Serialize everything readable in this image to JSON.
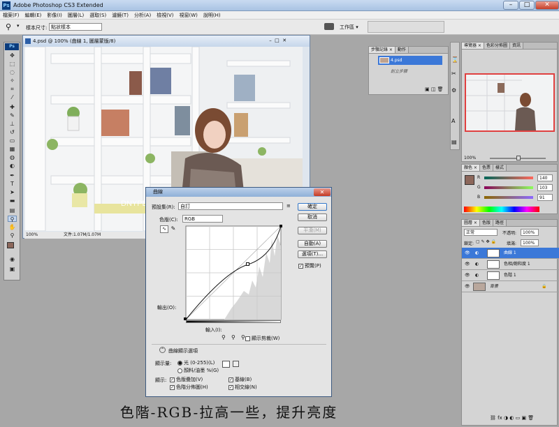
{
  "app": {
    "title": "Adobe Photoshop CS3 Extended",
    "logo": "Ps",
    "window_buttons": [
      "–",
      "□",
      "✕"
    ]
  },
  "menu": [
    "檔案(F)",
    "編輯(E)",
    "影像(I)",
    "圖層(L)",
    "選取(S)",
    "濾鏡(T)",
    "分析(A)",
    "檢視(V)",
    "視窗(W)",
    "說明(H)"
  ],
  "options": {
    "sample_label": "樣本尺寸:",
    "sample_value": "點狀樣本",
    "workspace": "工作區 ▾"
  },
  "document": {
    "title": "4.psd @ 100% (曲線 1, 圖層蒙版/8)",
    "zoom": "100%",
    "file_info": "文件:1.07M/1.07M",
    "watermark": "DNYPER"
  },
  "history": {
    "tabs": [
      "步驟記錄 ×",
      "動作"
    ],
    "items": [
      "4.psd",
      "創立步驟"
    ]
  },
  "navigator": {
    "tabs": [
      "導覽器 ×",
      "色彩分佈圖",
      "資訊"
    ],
    "zoom": "100%"
  },
  "color_panel": {
    "tabs": [
      "顏色 ×",
      "色票",
      "樣式"
    ],
    "channels": [
      {
        "name": "R",
        "value": "140"
      },
      {
        "name": "G",
        "value": "103"
      },
      {
        "name": "B",
        "value": "91"
      }
    ],
    "foreground": "#8c675b"
  },
  "layers": {
    "tabs": [
      "圖層 ×",
      "色版",
      "路徑"
    ],
    "blend_mode": "正常",
    "opacity_label": "不透明:",
    "opacity": "100%",
    "lock_label": "鎖定:",
    "fill_label": "填滿:",
    "fill": "100%",
    "items": [
      {
        "name": "曲線 1",
        "selected": true
      },
      {
        "name": "色相/飽和度 1",
        "selected": false
      },
      {
        "name": "色階 1",
        "selected": false
      },
      {
        "name": "背景",
        "selected": false
      }
    ]
  },
  "curves": {
    "title": "曲線",
    "preset_label": "預設集(R):",
    "preset_value": "自訂",
    "channel_label": "色版(C):",
    "channel_value": "RGB",
    "output_label": "輸出(O):",
    "input_label": "輸入(I):",
    "clipping_label": "顯示剪裁(W)",
    "buttons": {
      "ok": "確定",
      "cancel": "取消",
      "smooth": "平滑(M)",
      "auto": "自動(A)",
      "options": "選項(T)..."
    },
    "preview_label": "預覽(P)",
    "display_options": "曲線顯示選項",
    "show_amount_label": "顯示量:",
    "light_option": "光 (0-255)(L)",
    "pigment_option": "顏料/油墨 %(G)",
    "show_label": "顯示:",
    "checks": [
      "色版疊加(V)",
      "基線(B)",
      "色階分佈圖(H)",
      "相交線(N)"
    ],
    "curve_point": [
      128,
      152
    ]
  },
  "caption": "色階-RGB-拉高一些，提升亮度"
}
